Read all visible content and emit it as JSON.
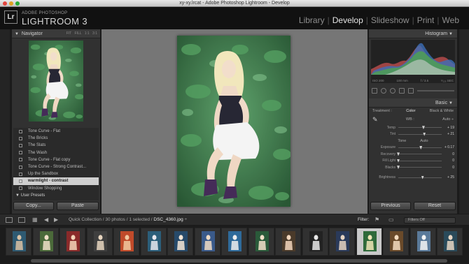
{
  "window": {
    "title": "xy-xy.lrcat - Adobe Photoshop Lightroom - Develop"
  },
  "identity": {
    "logo": "Lr",
    "brand_small": "ADOBE PHOTOSHOP",
    "brand_big": "LIGHTROOM 3"
  },
  "modules": [
    {
      "label": "Library",
      "active": false
    },
    {
      "label": "Develop",
      "active": true
    },
    {
      "label": "Slideshow",
      "active": false
    },
    {
      "label": "Print",
      "active": false
    },
    {
      "label": "Web",
      "active": false
    }
  ],
  "navigator": {
    "title": "Navigator",
    "tabs": "FIT  FILL  1:1  3:1"
  },
  "presets": [
    {
      "label": "Tone Curve - Flat",
      "type": "item",
      "active": false
    },
    {
      "label": "The Bricks",
      "type": "item",
      "active": false
    },
    {
      "label": "The Slats",
      "type": "item",
      "active": false
    },
    {
      "label": "The Wash",
      "type": "item",
      "active": false
    },
    {
      "label": "Tone Curve - Flat copy",
      "type": "item",
      "active": false
    },
    {
      "label": "Tone Curve - Strong Contrast...",
      "type": "item",
      "active": false
    },
    {
      "label": "Up the Sandbox",
      "type": "item",
      "active": false
    },
    {
      "label": "warmlight - contrast",
      "type": "item",
      "active": true
    },
    {
      "label": "Window Shopping",
      "type": "item",
      "active": false
    },
    {
      "label": "▼ User Presets",
      "type": "group",
      "active": false
    }
  ],
  "left_buttons": {
    "copy": "Copy...",
    "paste": "Paste"
  },
  "histogram": {
    "title": "Histogram",
    "iso": "ISO 200",
    "focal": "100 mm",
    "aperture": "f / 3.5",
    "shutter": "¹⁄₁₂₅ SEC"
  },
  "basic": {
    "title": "Basic",
    "treatment_label": "Treatment :",
    "treatment_color": "Color",
    "treatment_bw": "Black & White",
    "wb_label": "WB :",
    "wb_value": "Auto ÷",
    "tone_label": "Tone",
    "tone_auto": "Auto",
    "sliders": [
      {
        "label": "Temp",
        "value": "+ 19",
        "level": 0.58
      },
      {
        "label": "Tint",
        "value": "+ 21",
        "level": 0.6
      },
      {
        "label": "Exposure",
        "value": "+ 0.17",
        "level": 0.52
      },
      {
        "label": "Recovery",
        "value": "0",
        "level": 0.0
      },
      {
        "label": "Fill Light",
        "value": "0",
        "level": 0.0
      },
      {
        "label": "Blacks",
        "value": "0",
        "level": 0.0
      },
      {
        "label": "Brightness",
        "value": "+ 25",
        "level": 0.56
      }
    ]
  },
  "right_buttons": {
    "previous": "Previous",
    "reset": "Reset"
  },
  "toolbar": {
    "collection": "Quick Collection / 30 photos / 1 selected /",
    "filename": "DSC_4360.jpg",
    "filename_suffix": " ÷",
    "filter_label": "Filter:",
    "filter_value": "Filters Off"
  },
  "filmstrip": {
    "count": 17,
    "selected_index": 13
  }
}
